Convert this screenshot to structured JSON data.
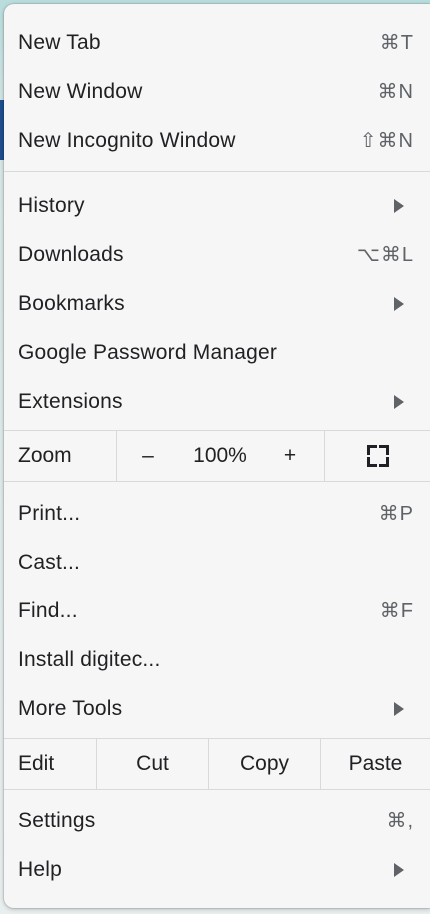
{
  "menu": {
    "group1": [
      {
        "label": "New Tab",
        "shortcut": "⌘T"
      },
      {
        "label": "New Window",
        "shortcut": "⌘N"
      },
      {
        "label": "New Incognito Window",
        "shortcut": "⇧⌘N"
      }
    ],
    "group2": [
      {
        "label": "History",
        "submenu": true
      },
      {
        "label": "Downloads",
        "shortcut": "⌥⌘L"
      },
      {
        "label": "Bookmarks",
        "submenu": true
      },
      {
        "label": "Google Password Manager"
      },
      {
        "label": "Extensions",
        "submenu": true
      }
    ],
    "zoom": {
      "label": "Zoom",
      "minus": "–",
      "value": "100%",
      "plus": "+",
      "fullscreen_icon": "fullscreen-icon"
    },
    "group3": [
      {
        "label": "Print...",
        "shortcut": "⌘P"
      },
      {
        "label": "Cast..."
      },
      {
        "label": "Find...",
        "shortcut": "⌘F"
      },
      {
        "label": "Install digitec..."
      },
      {
        "label": "More Tools",
        "submenu": true
      }
    ],
    "edit": {
      "label": "Edit",
      "cut": "Cut",
      "copy": "Copy",
      "paste": "Paste"
    },
    "group4": [
      {
        "label": "Settings",
        "shortcut": "⌘,"
      },
      {
        "label": "Help",
        "submenu": true
      }
    ]
  },
  "colors": {
    "menu_bg": "#f6f6f6",
    "text": "#202124",
    "secondary_text": "#5f6368",
    "separator": "#d9d9d9"
  }
}
